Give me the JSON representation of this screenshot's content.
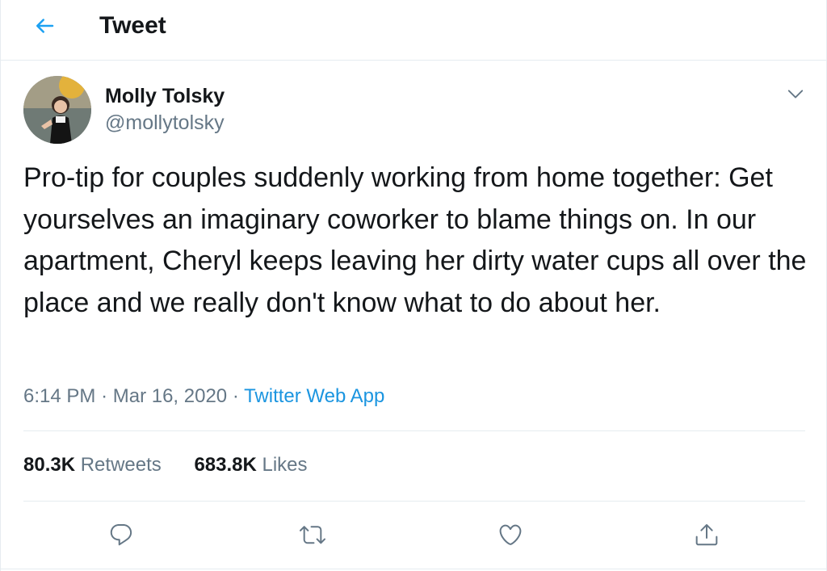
{
  "header": {
    "title": "Tweet",
    "back_icon": "arrow-left-icon",
    "accent_color": "#1da1f2"
  },
  "author": {
    "name": "Molly Tolsky",
    "handle": "@mollytolsky"
  },
  "tweet": {
    "text": "Pro-tip for couples suddenly working from home together: Get yourselves an imaginary coworker to blame things on. In our apartment, Cheryl keeps leaving her dirty water cups all over the place and we really don't know what to do about her.",
    "time": "6:14 PM",
    "separator": "·",
    "date": "Mar 16, 2020",
    "source": "Twitter Web App"
  },
  "stats": {
    "retweets_count": "80.3K",
    "retweets_label": "Retweets",
    "likes_count": "683.8K",
    "likes_label": "Likes"
  },
  "actions": [
    {
      "name": "reply",
      "icon": "reply-icon"
    },
    {
      "name": "retweet",
      "icon": "retweet-icon"
    },
    {
      "name": "like",
      "icon": "heart-icon"
    },
    {
      "name": "share",
      "icon": "share-icon"
    }
  ],
  "colors": {
    "text_primary": "#14171a",
    "text_secondary": "#657786",
    "link": "#1b95e0",
    "border": "#e6ecf0"
  }
}
